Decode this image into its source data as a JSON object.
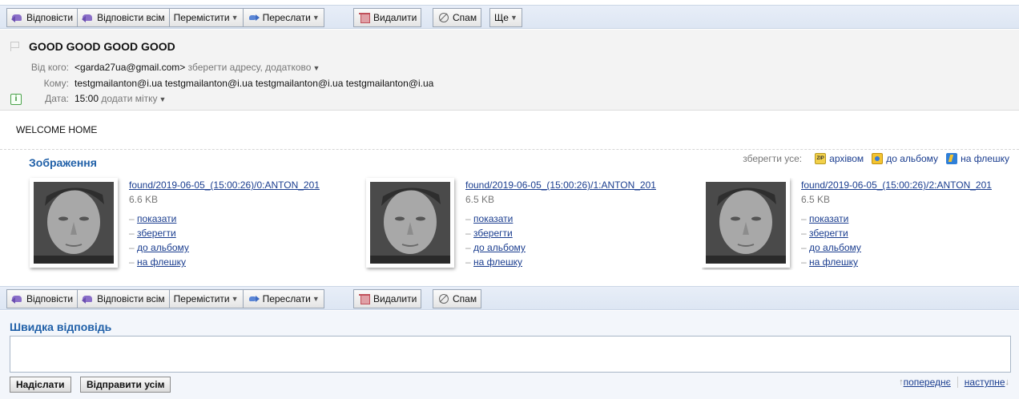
{
  "toolbar_top": {
    "reply": "Відповісти",
    "reply_all": "Відповісти всім",
    "move": "Перемістити",
    "forward": "Переслати",
    "delete": "Видалити",
    "spam": "Спам",
    "more": "Ще"
  },
  "message": {
    "subject": "GOOD GOOD GOOD GOOD",
    "from_label": "Від кого:",
    "from_prefix": "<",
    "from_email": "garda27ua@gmail.com",
    "from_suffix": ">",
    "save_address": "зберегти адресу",
    "more": "додатково",
    "to_label": "Кому:",
    "to_value": "testgmailanton@i.ua testgmailanton@i.ua testgmailanton@i.ua testgmailanton@i.ua",
    "date_label": "Дата:",
    "date_value": "15:00",
    "add_label": "додати мітку",
    "body": "WELCOME HOME"
  },
  "attachments": {
    "title": "Зображення",
    "save_all_label": "зберегти усе:",
    "save_archive": "архівом",
    "save_album": "до альбому",
    "save_flash": "на флешку",
    "zip_icon_text": "ZIP",
    "items": [
      {
        "name": "found/2019-06-05_(15:00:26)/0:ANTON_201",
        "size": "6.6 KB"
      },
      {
        "name": "found/2019-06-05_(15:00:26)/1:ANTON_201",
        "size": "6.5 KB"
      },
      {
        "name": "found/2019-06-05_(15:00:26)/2:ANTON_201",
        "size": "6.5 KB"
      }
    ],
    "actions": {
      "show": "показати",
      "save": "зберегти",
      "album": "до альбому",
      "flash": "на флешку"
    },
    "dash": "–"
  },
  "toolbar_bottom": {
    "reply": "Відповісти",
    "reply_all": "Відповісти всім",
    "move": "Перемістити",
    "forward": "Переслати",
    "delete": "Видалити",
    "spam": "Спам"
  },
  "quick_reply": {
    "title": "Швидка відповідь",
    "send": "Надіслати",
    "send_all": "Відправити усім",
    "prev": "попереднє",
    "next": "наступне"
  },
  "icons": {
    "reply": "reply-icon",
    "forward": "forward-icon",
    "delete": "trash-icon",
    "spam": "spam-icon",
    "flag": "flag-icon",
    "info": "info-icon"
  },
  "colors": {
    "accent": "#2060a8",
    "link": "#1a3d8f",
    "toolbar": "#dde6f3"
  }
}
